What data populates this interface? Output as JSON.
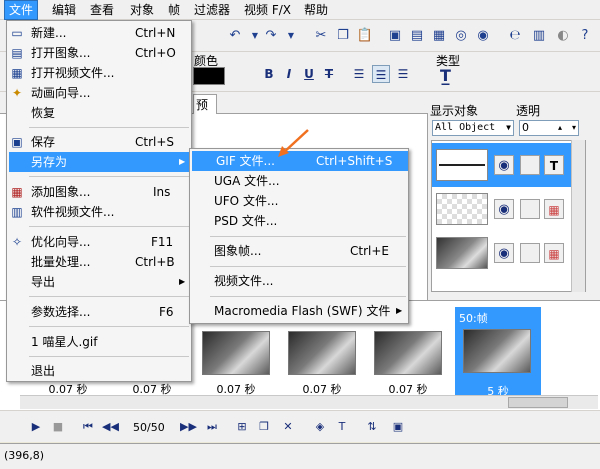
{
  "menubar": [
    "文件",
    "编辑",
    "查看",
    "对象",
    "帧",
    "过滤器",
    "视频 F/X",
    "帮助"
  ],
  "toolbar": {
    "color_label": "颜色",
    "type_label": "类型",
    "format_buttons": [
      "B",
      "I",
      "U",
      "T"
    ]
  },
  "canvas": {
    "tab_label": "预"
  },
  "object_panel": {
    "display_label": "显示对象",
    "opacity_label": "透明",
    "display_value": "All Object",
    "opacity_value": "0"
  },
  "file_menu": {
    "items": [
      {
        "label": "新建...",
        "shortcut": "Ctrl+N",
        "icon": "new-file-icon"
      },
      {
        "label": "打开图象...",
        "shortcut": "Ctrl+O",
        "icon": "open-image-icon"
      },
      {
        "label": "打开视频文件...",
        "shortcut": "",
        "icon": "open-video-icon"
      },
      {
        "label": "动画向导...",
        "shortcut": "",
        "icon": "wizard-icon"
      },
      {
        "label": "恢复",
        "shortcut": "",
        "icon": ""
      },
      {
        "label": "保存",
        "shortcut": "Ctrl+S",
        "icon": "save-icon"
      },
      {
        "label": "另存为",
        "shortcut": "",
        "icon": "",
        "submenu": true
      },
      {
        "label": "添加图象...",
        "shortcut": "Ins",
        "icon": "add-image-icon"
      },
      {
        "label": "软件视频文件...",
        "shortcut": "",
        "icon": "video-file-icon"
      },
      {
        "label": "优化向导...",
        "shortcut": "F11",
        "icon": "optimize-icon"
      },
      {
        "label": "批量处理...",
        "shortcut": "Ctrl+B",
        "icon": ""
      },
      {
        "label": "导出",
        "shortcut": "",
        "icon": "",
        "submenu": true
      },
      {
        "label": "参数选择...",
        "shortcut": "F6",
        "icon": ""
      },
      {
        "label": "1 喵星人.gif",
        "shortcut": "",
        "icon": ""
      },
      {
        "label": "退出",
        "shortcut": "",
        "icon": ""
      }
    ]
  },
  "saveas_menu": {
    "items": [
      {
        "label": "GIF 文件...",
        "shortcut": "Ctrl+Shift+S"
      },
      {
        "label": "UGA 文件..."
      },
      {
        "label": "UFO 文件..."
      },
      {
        "label": "PSD 文件..."
      },
      {
        "label": "图象帧...",
        "shortcut": "Ctrl+E"
      },
      {
        "label": "视频文件..."
      },
      {
        "label": "Macromedia Flash (SWF) 文件"
      }
    ]
  },
  "frames": {
    "durations": [
      "0.07 秒",
      "0.07 秒",
      "0.07 秒",
      "0.07 秒",
      "0.07 秒",
      "0.07 秒"
    ],
    "selected_title": "50:帧",
    "selected_duration": "5 秒"
  },
  "playback": {
    "counter": "50/50"
  },
  "status": {
    "coords": "(396,8)"
  },
  "colors": {
    "highlight": "#3399ff",
    "arrow": "#f07020"
  }
}
